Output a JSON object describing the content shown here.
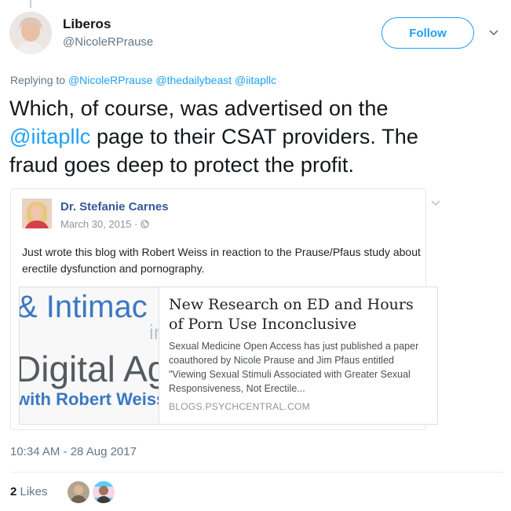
{
  "header": {
    "display_name": "Liberos",
    "handle": "@NicoleRPrause",
    "follow_label": "Follow"
  },
  "reply": {
    "prefix": "Replying to",
    "mentions": [
      "@NicoleRPrause",
      "@thedailybeast",
      "@iitapllc"
    ]
  },
  "tweet": {
    "line1": "Which, of course, was advertised on the",
    "mention": "@iitapllc",
    "line2_rest": " page to their CSAT providers. The",
    "line3": "fraud goes deep to protect the profit."
  },
  "quoted_post": {
    "author": "Dr. Stefanie Carnes",
    "date": "March 30, 2015 · ",
    "text": "Just wrote this blog with Robert Weiss in reaction to the Prause/Pfaus study about erectile dysfunction and pornography.",
    "link": {
      "image_text": {
        "line1": "& Intimac",
        "line2_small": "in",
        "line3": "Digital Ag",
        "line4": "with Robert Weiss"
      },
      "title": "New Research on ED and Hours of Porn Use Inconclusive",
      "description": "Sexual Medicine Open Access has just published a paper coauthored by Nicole Prause and Jim Pfaus entitled \"Viewing Sexual Stimuli Associated with Greater Sexual Responsiveness, Not Erectile...",
      "domain": "BLOGS.PSYCHCENTRAL.COM"
    }
  },
  "timestamp": "10:34 AM - 28 Aug 2017",
  "likes": {
    "count": "2",
    "label": " Likes"
  },
  "colors": {
    "accent": "#1da1f2",
    "facebook_name": "#365899",
    "muted": "#657786"
  },
  "icons": [
    "chevron-down-icon",
    "globe-icon"
  ]
}
